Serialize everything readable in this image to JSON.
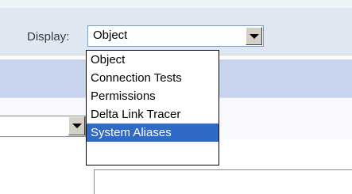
{
  "colors": {
    "header_band": "#dfe7f3",
    "mid_band": "#c6d5ed",
    "selection": "#316ac5"
  },
  "display": {
    "label": "Display:",
    "selected": "Object",
    "options": [
      "Object",
      "Connection Tests",
      "Permissions",
      "Delta Link Tracer",
      "System Aliases"
    ],
    "highlighted_option": "System Aliases"
  }
}
